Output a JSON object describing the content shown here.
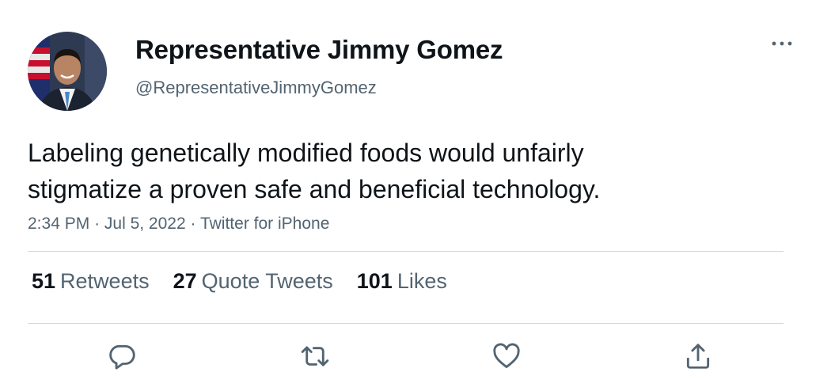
{
  "author": {
    "name": "Representative Jimmy Gomez",
    "handle": "@RepresentativeJimmyGomez"
  },
  "tweet": {
    "line1": "Labeling genetically modified foods would unfairly",
    "line2": "stigmatize a proven safe and beneficial technology."
  },
  "meta": {
    "time": "2:34 PM",
    "date": "Jul 5, 2022",
    "source": "Twitter for iPhone",
    "separator": "·"
  },
  "stats": {
    "retweets_count": "51",
    "retweets_label": "Retweets",
    "quotes_count": "27",
    "quotes_label": "Quote Tweets",
    "likes_count": "101",
    "likes_label": "Likes"
  },
  "icons": {
    "more": "more-horizontal-icon",
    "reply": "reply-icon",
    "retweet": "retweet-icon",
    "like": "heart-icon",
    "share": "share-icon"
  },
  "colors": {
    "text": "#0f1419",
    "secondary": "#536471",
    "divider": "#cfd9de"
  }
}
